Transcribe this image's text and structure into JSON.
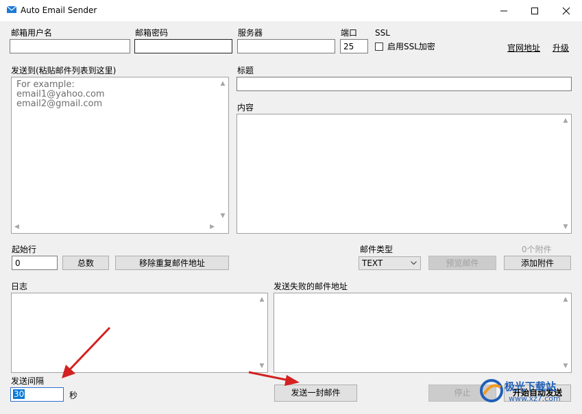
{
  "window": {
    "title": "Auto Email Sender",
    "minimize": "—",
    "maximize": "☐",
    "close": "✕"
  },
  "account": {
    "username_label": "邮箱用户名",
    "username_value": "",
    "password_label": "邮箱密码",
    "password_value": "",
    "server_label": "服务器",
    "server_value": "",
    "port_label": "端口",
    "port_value": "25",
    "ssl_label": "SSL",
    "ssl_checkbox_label": "启用SSL加密",
    "ssl_checked": false
  },
  "links": {
    "website": "官网地址",
    "upgrade": "升级"
  },
  "recipients": {
    "label": "发送到(粘贴邮件列表到这里)",
    "placeholder_lines": [
      "For example:",
      "email1@yahoo.com",
      "email2@gmail.com"
    ]
  },
  "message": {
    "subject_label": "标题",
    "subject_value": "",
    "content_label": "内容",
    "content_value": ""
  },
  "controls": {
    "start_row_label": "起始行",
    "start_row_value": "0",
    "total_button": "总数",
    "remove_duplicates_button": "移除重复邮件地址",
    "mail_type_label": "邮件类型",
    "mail_type_value": "TEXT",
    "attachments_count": "0个附件",
    "preview_button": "预览邮件",
    "add_attachment_button": "添加附件"
  },
  "log": {
    "label": "日志",
    "failed_label": "发送失败的邮件地址"
  },
  "footer": {
    "interval_label": "发送间隔",
    "interval_value": "30",
    "interval_unit": "秒",
    "send_one_button": "发送一封邮件",
    "stop_button": "停止",
    "auto_send_button": "开始自动发送"
  },
  "watermark": {
    "text": "极光下载站",
    "url": "www.xz7.com"
  },
  "colors": {
    "annotation_arrow": "#d42020",
    "watermark_blue": "#1f5fb8"
  }
}
